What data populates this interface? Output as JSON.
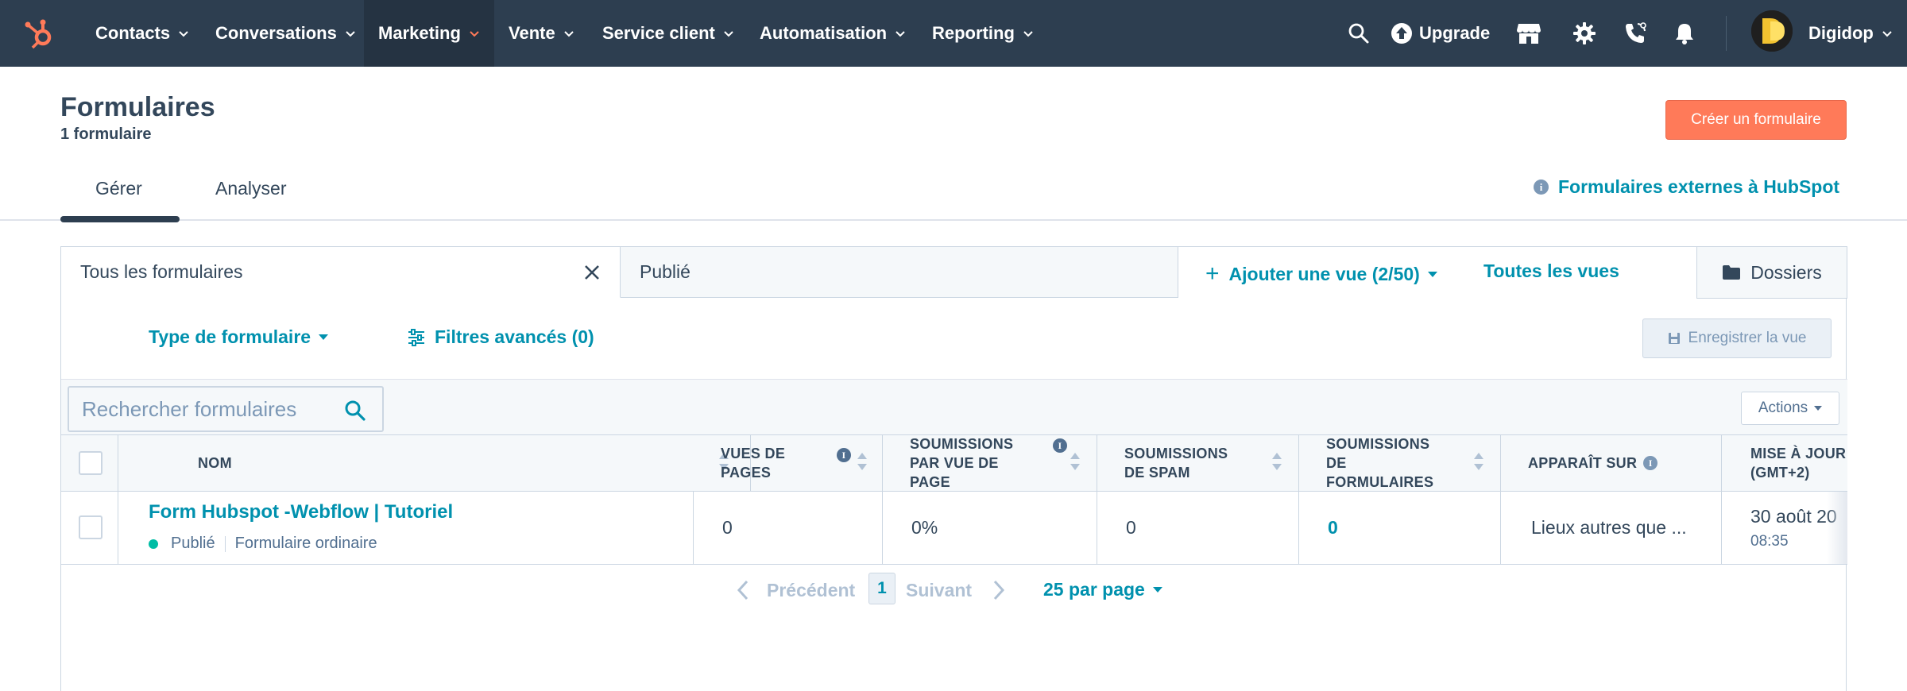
{
  "nav": {
    "items": [
      {
        "label": "Contacts"
      },
      {
        "label": "Conversations"
      },
      {
        "label": "Marketing"
      },
      {
        "label": "Vente"
      },
      {
        "label": "Service client"
      },
      {
        "label": "Automatisation"
      },
      {
        "label": "Reporting"
      }
    ],
    "active_item": "Marketing",
    "upgrade_label": "Upgrade",
    "account_name": "Digidop",
    "icons": [
      "hubspot-logo",
      "search-icon",
      "upgrade-icon",
      "marketplace-icon",
      "gear-icon",
      "phone-icon",
      "bell-icon"
    ]
  },
  "header": {
    "title": "Formulaires",
    "count_label": "1 formulaire",
    "create_button": "Créer un formulaire"
  },
  "tabs": [
    {
      "label": "Gérer",
      "active": true
    },
    {
      "label": "Analyser",
      "active": false
    }
  ],
  "external_link": "Formulaires externes à HubSpot",
  "views": {
    "tab_all": "Tous les formulaires",
    "tab_published": "Publié",
    "add_view": "Ajouter une vue (2/50)",
    "all_views": "Toutes les vues",
    "folders": "Dossiers"
  },
  "filters": {
    "form_type": "Type de formulaire",
    "advanced": "Filtres avancés (0)",
    "save_view": "Enregistrer la vue"
  },
  "search": {
    "placeholder": "Rechercher formulaires"
  },
  "actions_button": "Actions",
  "table": {
    "columns": [
      "NOM",
      "VUES DE PAGES",
      "SOUMISSIONS PAR VUE DE PAGE",
      "SOUMISSIONS DE SPAM",
      "SOUMISSIONS DE FORMULAIRES",
      "APPARAÎT SUR",
      "MISE À JOUR (GMT+2)"
    ],
    "rows": [
      {
        "name": "Form Hubspot -Webflow | Tutoriel",
        "status": "Publié",
        "type": "Formulaire ordinaire",
        "page_views": "0",
        "submissions_per_view": "0%",
        "spam": "0",
        "submissions": "0",
        "appears_on": "Lieux autres que ...",
        "updated_date": "30 août 20",
        "updated_time": "08:35"
      }
    ]
  },
  "pagination": {
    "previous": "Précédent",
    "page": "1",
    "next": "Suivant",
    "per_page": "25 par page"
  },
  "colors": {
    "nav_bg": "#2d3e50",
    "accent_orange": "#ff7a59",
    "link_blue": "#0091ae",
    "status_green": "#00bda5"
  }
}
